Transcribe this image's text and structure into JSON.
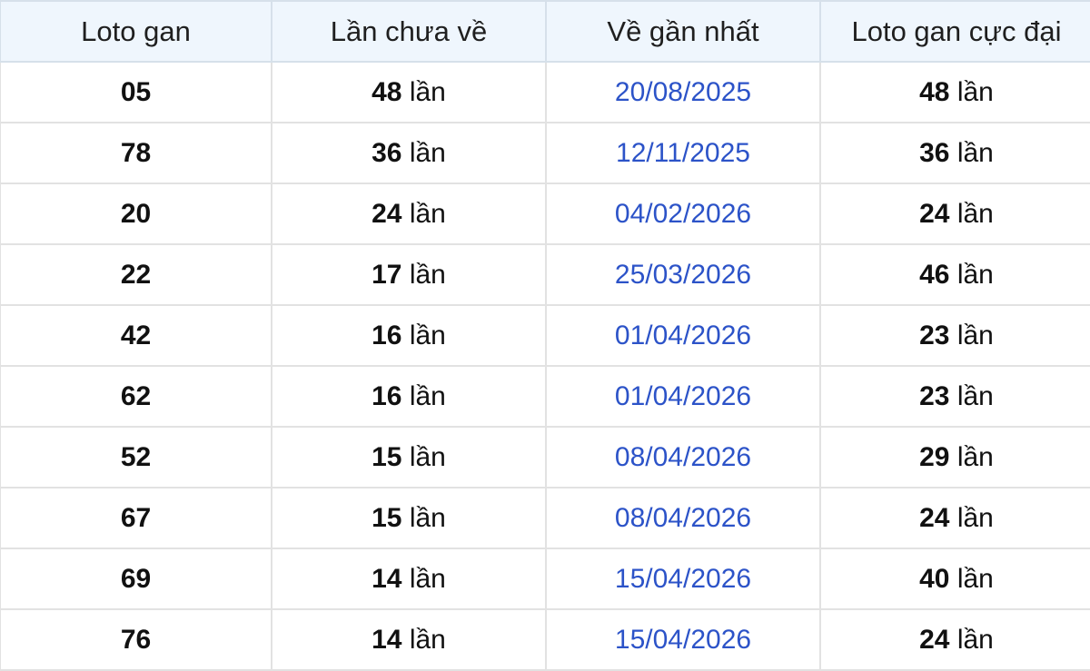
{
  "table": {
    "headers": [
      "Loto gan",
      "Lần chưa về",
      "Về gần nhất",
      "Loto gan cực đại"
    ],
    "unit": "lần",
    "rows": [
      {
        "loto": "05",
        "missed": "48",
        "last_seen": "20/08/2025",
        "max_gan": "48"
      },
      {
        "loto": "78",
        "missed": "36",
        "last_seen": "12/11/2025",
        "max_gan": "36"
      },
      {
        "loto": "20",
        "missed": "24",
        "last_seen": "04/02/2026",
        "max_gan": "24"
      },
      {
        "loto": "22",
        "missed": "17",
        "last_seen": "25/03/2026",
        "max_gan": "46"
      },
      {
        "loto": "42",
        "missed": "16",
        "last_seen": "01/04/2026",
        "max_gan": "23"
      },
      {
        "loto": "62",
        "missed": "16",
        "last_seen": "01/04/2026",
        "max_gan": "23"
      },
      {
        "loto": "52",
        "missed": "15",
        "last_seen": "08/04/2026",
        "max_gan": "29"
      },
      {
        "loto": "67",
        "missed": "15",
        "last_seen": "08/04/2026",
        "max_gan": "24"
      },
      {
        "loto": "69",
        "missed": "14",
        "last_seen": "15/04/2026",
        "max_gan": "40"
      },
      {
        "loto": "76",
        "missed": "14",
        "last_seen": "15/04/2026",
        "max_gan": "24"
      }
    ]
  },
  "colors": {
    "header_bg": "#eff6fd",
    "date_text": "#2c53c8",
    "border": "#e2e2e2"
  }
}
